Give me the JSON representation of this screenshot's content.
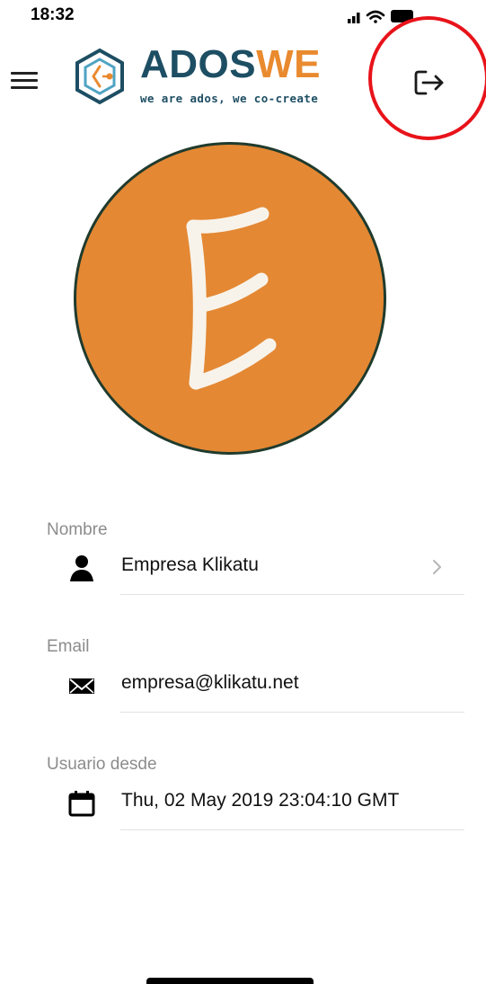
{
  "status_bar": {
    "time": "18:32"
  },
  "header": {
    "logo_part1": "ADOS",
    "logo_part2": "WE",
    "logo_tagline": "we are ados, we co-create"
  },
  "avatar": {
    "letter": "E",
    "background": "#e48834",
    "border": "#1f3b2d"
  },
  "fields": [
    {
      "label": "Nombre",
      "icon": "person-icon",
      "value": "Empresa Klikatu",
      "has_chevron": true
    },
    {
      "label": "Email",
      "icon": "envelope-icon",
      "value": "empresa@klikatu.net",
      "has_chevron": false
    },
    {
      "label": "Usuario desde",
      "icon": "calendar-icon",
      "value": "Thu, 02 May 2019 23:04:10 GMT",
      "has_chevron": false
    }
  ],
  "colors": {
    "brand_dark": "#1d4e63",
    "brand_orange": "#e98a2f",
    "highlight": "#e8131a"
  }
}
